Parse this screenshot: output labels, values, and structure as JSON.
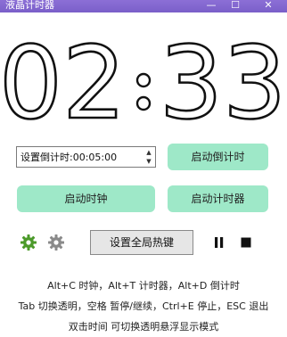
{
  "window": {
    "title": "液晶计时器",
    "minimize_glyph": "—",
    "maximize_glyph": "☐",
    "close_glyph": "✕"
  },
  "clock": {
    "hours": "02",
    "separator": ":",
    "minutes": "33"
  },
  "countdown": {
    "value": "设置倒计时:00:05:00",
    "up_glyph": "▲",
    "down_glyph": "▼"
  },
  "buttons": {
    "start_countdown": "启动倒计时",
    "start_clock": "启动时钟",
    "start_timer": "启动计时器",
    "set_hotkeys": "设置全局热键"
  },
  "icons": {
    "settings_green": "gear-icon",
    "settings_gray": "gear-icon",
    "pause": "pause-icon",
    "stop": "stop-icon"
  },
  "colors": {
    "accent_green": "#9ee8c8",
    "title_bar": "#7a5fc9",
    "gear_green": "#4c9a2a",
    "gear_gray": "#8a8a8a"
  },
  "hints": {
    "line1": "Alt+C 时钟，Alt+T 计时器，Alt+D 倒计时",
    "line2": "Tab 切换透明，空格 暂停/继续，Ctrl+E 停止，ESC 退出",
    "line3": "双击时间 可切换透明悬浮显示模式"
  }
}
